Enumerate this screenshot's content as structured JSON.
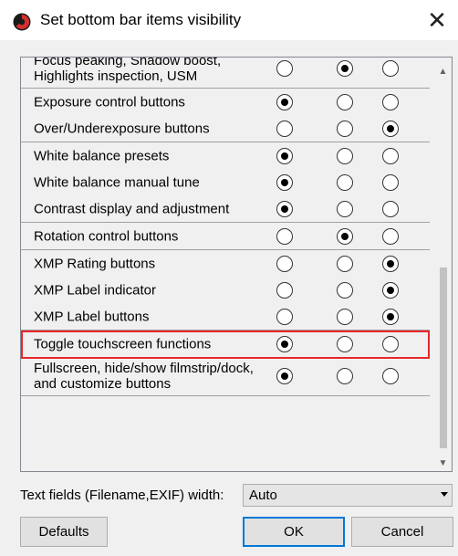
{
  "window": {
    "title": "Set bottom bar items visibility",
    "close_glyph": "✕"
  },
  "groups": [
    {
      "rows": [
        {
          "label_lines": [
            "Focus peaking, Shadow boost,",
            "Highlights inspection, USM"
          ],
          "selected": 2
        }
      ]
    },
    {
      "rows": [
        {
          "label_lines": [
            "Exposure control buttons"
          ],
          "selected": 1
        },
        {
          "label_lines": [
            "Over/Underexposure buttons"
          ],
          "selected": 3
        }
      ]
    },
    {
      "rows": [
        {
          "label_lines": [
            "White balance presets"
          ],
          "selected": 1
        },
        {
          "label_lines": [
            "White balance manual tune"
          ],
          "selected": 1
        },
        {
          "label_lines": [
            "Contrast display and adjustment"
          ],
          "selected": 1
        }
      ]
    },
    {
      "rows": [
        {
          "label_lines": [
            "Rotation control buttons"
          ],
          "selected": 2
        }
      ]
    },
    {
      "rows": [
        {
          "label_lines": [
            "XMP Rating buttons"
          ],
          "selected": 3
        },
        {
          "label_lines": [
            "XMP Label indicator"
          ],
          "selected": 3
        },
        {
          "label_lines": [
            "XMP Label buttons"
          ],
          "selected": 3
        }
      ]
    },
    {
      "rows": [
        {
          "label_lines": [
            "Toggle touchscreen functions"
          ],
          "selected": 1,
          "highlighted": true
        },
        {
          "label_lines": [
            "Fullscreen, hide/show filmstrip/dock,",
            "and customize buttons"
          ],
          "selected": 1
        }
      ]
    }
  ],
  "text_fields": {
    "label": "Text fields (Filename,EXIF) width:",
    "value": "Auto"
  },
  "buttons": {
    "defaults": "Defaults",
    "ok": "OK",
    "cancel": "Cancel"
  },
  "colors": {
    "highlight": "#e8262b",
    "accent": "#0078d7",
    "app_icon_red": "#d32f2f"
  }
}
